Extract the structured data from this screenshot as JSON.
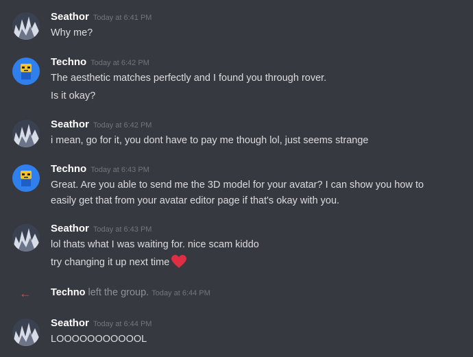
{
  "messages": [
    {
      "author": "Seathor",
      "timestamp": "Today at 6:41 PM",
      "avatar": "seathor-avatar",
      "lines": [
        "Why me?"
      ]
    },
    {
      "author": "Techno",
      "timestamp": "Today at 6:42 PM",
      "avatar": "techno-avatar",
      "lines": [
        "The aesthetic matches perfectly and I found you through rover.",
        "Is it okay?"
      ]
    },
    {
      "author": "Seathor",
      "timestamp": "Today at 6:42 PM",
      "avatar": "seathor-avatar",
      "lines": [
        "i mean, go for it, you dont have to pay me though lol, just seems strange"
      ]
    },
    {
      "author": "Techno",
      "timestamp": "Today at 6:43 PM",
      "avatar": "techno-avatar",
      "lines": [
        "Great. Are you able to send me the 3D model for your avatar? I can show you how to",
        "easily get that from your avatar editor page if that's okay with you."
      ]
    },
    {
      "author": "Seathor",
      "timestamp": "Today at 6:43 PM",
      "avatar": "seathor-avatar",
      "lines": [
        "lol thats what I was waiting for. nice scam kiddo",
        "try changing it up next time"
      ]
    },
    {
      "author": "Seathor",
      "timestamp": "Today at 6:44 PM",
      "avatar": "seathor-avatar",
      "lines": [
        "LOOOOOOOOOOOL"
      ]
    }
  ],
  "system": {
    "icon": "leave-arrow-icon",
    "name": "Techno",
    "action": " left the group.",
    "timestamp": "Today at 6:44 PM"
  },
  "emoji": {
    "heart": "red-heart-emoji"
  },
  "colors": {
    "background": "#36393f",
    "username": "#ffffff",
    "text": "#dcddde",
    "timestamp": "#72767d",
    "leave_arrow": "#ed4245",
    "techno_avatar_bg": "#2f80ed"
  }
}
